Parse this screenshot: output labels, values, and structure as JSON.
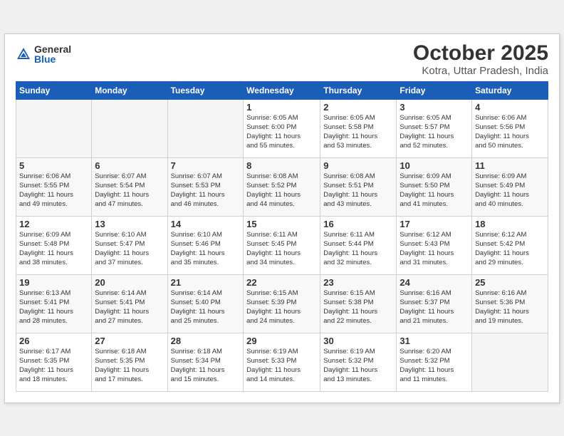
{
  "header": {
    "logo_general": "General",
    "logo_blue": "Blue",
    "month_title": "October 2025",
    "location": "Kotra, Uttar Pradesh, India"
  },
  "days_of_week": [
    "Sunday",
    "Monday",
    "Tuesday",
    "Wednesday",
    "Thursday",
    "Friday",
    "Saturday"
  ],
  "weeks": [
    [
      {
        "day": "",
        "info": ""
      },
      {
        "day": "",
        "info": ""
      },
      {
        "day": "",
        "info": ""
      },
      {
        "day": "1",
        "info": "Sunrise: 6:05 AM\nSunset: 6:00 PM\nDaylight: 11 hours\nand 55 minutes."
      },
      {
        "day": "2",
        "info": "Sunrise: 6:05 AM\nSunset: 5:58 PM\nDaylight: 11 hours\nand 53 minutes."
      },
      {
        "day": "3",
        "info": "Sunrise: 6:05 AM\nSunset: 5:57 PM\nDaylight: 11 hours\nand 52 minutes."
      },
      {
        "day": "4",
        "info": "Sunrise: 6:06 AM\nSunset: 5:56 PM\nDaylight: 11 hours\nand 50 minutes."
      }
    ],
    [
      {
        "day": "5",
        "info": "Sunrise: 6:06 AM\nSunset: 5:55 PM\nDaylight: 11 hours\nand 49 minutes."
      },
      {
        "day": "6",
        "info": "Sunrise: 6:07 AM\nSunset: 5:54 PM\nDaylight: 11 hours\nand 47 minutes."
      },
      {
        "day": "7",
        "info": "Sunrise: 6:07 AM\nSunset: 5:53 PM\nDaylight: 11 hours\nand 46 minutes."
      },
      {
        "day": "8",
        "info": "Sunrise: 6:08 AM\nSunset: 5:52 PM\nDaylight: 11 hours\nand 44 minutes."
      },
      {
        "day": "9",
        "info": "Sunrise: 6:08 AM\nSunset: 5:51 PM\nDaylight: 11 hours\nand 43 minutes."
      },
      {
        "day": "10",
        "info": "Sunrise: 6:09 AM\nSunset: 5:50 PM\nDaylight: 11 hours\nand 41 minutes."
      },
      {
        "day": "11",
        "info": "Sunrise: 6:09 AM\nSunset: 5:49 PM\nDaylight: 11 hours\nand 40 minutes."
      }
    ],
    [
      {
        "day": "12",
        "info": "Sunrise: 6:09 AM\nSunset: 5:48 PM\nDaylight: 11 hours\nand 38 minutes."
      },
      {
        "day": "13",
        "info": "Sunrise: 6:10 AM\nSunset: 5:47 PM\nDaylight: 11 hours\nand 37 minutes."
      },
      {
        "day": "14",
        "info": "Sunrise: 6:10 AM\nSunset: 5:46 PM\nDaylight: 11 hours\nand 35 minutes."
      },
      {
        "day": "15",
        "info": "Sunrise: 6:11 AM\nSunset: 5:45 PM\nDaylight: 11 hours\nand 34 minutes."
      },
      {
        "day": "16",
        "info": "Sunrise: 6:11 AM\nSunset: 5:44 PM\nDaylight: 11 hours\nand 32 minutes."
      },
      {
        "day": "17",
        "info": "Sunrise: 6:12 AM\nSunset: 5:43 PM\nDaylight: 11 hours\nand 31 minutes."
      },
      {
        "day": "18",
        "info": "Sunrise: 6:12 AM\nSunset: 5:42 PM\nDaylight: 11 hours\nand 29 minutes."
      }
    ],
    [
      {
        "day": "19",
        "info": "Sunrise: 6:13 AM\nSunset: 5:41 PM\nDaylight: 11 hours\nand 28 minutes."
      },
      {
        "day": "20",
        "info": "Sunrise: 6:14 AM\nSunset: 5:41 PM\nDaylight: 11 hours\nand 27 minutes."
      },
      {
        "day": "21",
        "info": "Sunrise: 6:14 AM\nSunset: 5:40 PM\nDaylight: 11 hours\nand 25 minutes."
      },
      {
        "day": "22",
        "info": "Sunrise: 6:15 AM\nSunset: 5:39 PM\nDaylight: 11 hours\nand 24 minutes."
      },
      {
        "day": "23",
        "info": "Sunrise: 6:15 AM\nSunset: 5:38 PM\nDaylight: 11 hours\nand 22 minutes."
      },
      {
        "day": "24",
        "info": "Sunrise: 6:16 AM\nSunset: 5:37 PM\nDaylight: 11 hours\nand 21 minutes."
      },
      {
        "day": "25",
        "info": "Sunrise: 6:16 AM\nSunset: 5:36 PM\nDaylight: 11 hours\nand 19 minutes."
      }
    ],
    [
      {
        "day": "26",
        "info": "Sunrise: 6:17 AM\nSunset: 5:35 PM\nDaylight: 11 hours\nand 18 minutes."
      },
      {
        "day": "27",
        "info": "Sunrise: 6:18 AM\nSunset: 5:35 PM\nDaylight: 11 hours\nand 17 minutes."
      },
      {
        "day": "28",
        "info": "Sunrise: 6:18 AM\nSunset: 5:34 PM\nDaylight: 11 hours\nand 15 minutes."
      },
      {
        "day": "29",
        "info": "Sunrise: 6:19 AM\nSunset: 5:33 PM\nDaylight: 11 hours\nand 14 minutes."
      },
      {
        "day": "30",
        "info": "Sunrise: 6:19 AM\nSunset: 5:32 PM\nDaylight: 11 hours\nand 13 minutes."
      },
      {
        "day": "31",
        "info": "Sunrise: 6:20 AM\nSunset: 5:32 PM\nDaylight: 11 hours\nand 11 minutes."
      },
      {
        "day": "",
        "info": ""
      }
    ]
  ]
}
